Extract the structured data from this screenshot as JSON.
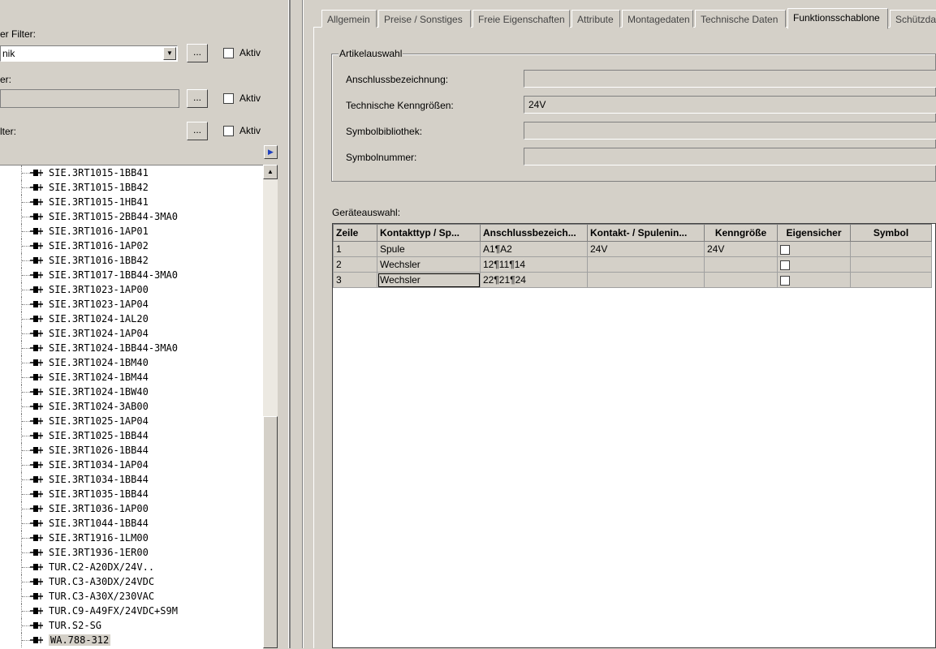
{
  "left": {
    "filter1_label": "er Filter:",
    "filter1_value": "nik",
    "filter2_label": "er:",
    "filter3_label": "lter:",
    "dots": "...",
    "aktiv": "Aktiv",
    "tree_items": [
      "SIE.3RT1015-1BB41",
      "SIE.3RT1015-1BB42",
      "SIE.3RT1015-1HB41",
      "SIE.3RT1015-2BB44-3MA0",
      "SIE.3RT1016-1AP01",
      "SIE.3RT1016-1AP02",
      "SIE.3RT1016-1BB42",
      "SIE.3RT1017-1BB44-3MA0",
      "SIE.3RT1023-1AP00",
      "SIE.3RT1023-1AP04",
      "SIE.3RT1024-1AL20",
      "SIE.3RT1024-1AP04",
      "SIE.3RT1024-1BB44-3MA0",
      "SIE.3RT1024-1BM40",
      "SIE.3RT1024-1BM44",
      "SIE.3RT1024-1BW40",
      "SIE.3RT1024-3AB00",
      "SIE.3RT1025-1AP04",
      "SIE.3RT1025-1BB44",
      "SIE.3RT1026-1BB44",
      "SIE.3RT1034-1AP04",
      "SIE.3RT1034-1BB44",
      "SIE.3RT1035-1BB44",
      "SIE.3RT1036-1AP00",
      "SIE.3RT1044-1BB44",
      "SIE.3RT1916-1LM00",
      "SIE.3RT1936-1ER00",
      "TUR.C2-A20DX/24V..",
      "TUR.C3-A30DX/24VDC",
      "TUR.C3-A30X/230VAC",
      "TUR.C9-A49FX/24VDC+S9M",
      "TUR.S2-SG",
      "WA.788-312"
    ]
  },
  "tabs": [
    {
      "label": "Allgemein",
      "active": false
    },
    {
      "label": "Preise / Sonstiges",
      "active": false
    },
    {
      "label": "Freie Eigenschaften",
      "active": false
    },
    {
      "label": "Attribute",
      "active": false
    },
    {
      "label": "Montagedaten",
      "active": false
    },
    {
      "label": "Technische Daten",
      "active": false
    },
    {
      "label": "Funktionsschablone",
      "active": true
    },
    {
      "label": "Schützda",
      "active": false
    }
  ],
  "article": {
    "legend": "Artikelauswahl",
    "anschluss_label": "Anschlussbezeichnung:",
    "anschluss_value": "",
    "kenn_label": "Technische Kenngrößen:",
    "kenn_value": "24V",
    "symbib_label": "Symbolbibliothek:",
    "symbib_value": "",
    "symnr_label": "Symbolnummer:",
    "symnr_value": ""
  },
  "device": {
    "label": "Geräteauswahl:",
    "columns": [
      "Zeile",
      "Kontakttyp / Sp...",
      "Anschlussbezeich...",
      "Kontakt- / Spulenin...",
      "Kenngröße",
      "Eigensicher",
      "Symbol"
    ],
    "rows": [
      {
        "zeile": "1",
        "typ": "Spule",
        "anschluss": "A1¶A2",
        "kontakt": "24V",
        "kenn": "24V",
        "eigensicher": false,
        "symbol": ""
      },
      {
        "zeile": "2",
        "typ": "Wechsler",
        "anschluss": "12¶11¶14",
        "kontakt": "",
        "kenn": "",
        "eigensicher": false,
        "symbol": ""
      },
      {
        "zeile": "3",
        "typ": "Wechsler",
        "anschluss": "22¶21¶24",
        "kontakt": "",
        "kenn": "",
        "eigensicher": false,
        "symbol": ""
      }
    ]
  }
}
